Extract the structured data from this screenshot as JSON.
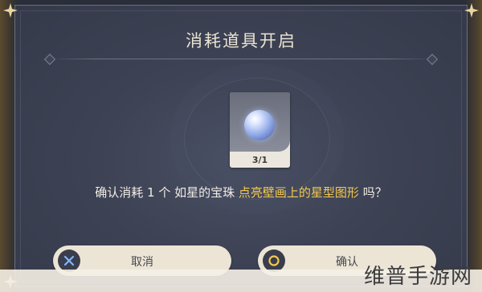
{
  "dialog": {
    "title": "消耗道具开启",
    "item": {
      "icon": "pearl-orb-icon",
      "count": "3/1"
    },
    "message": {
      "prefix": "确认消耗 1 个 如星的宝珠 ",
      "highlight": "点亮壁画上的星型图形",
      "suffix": " 吗？"
    },
    "cancel_button": {
      "label": "取消",
      "icon": "close-x-icon"
    },
    "confirm_button": {
      "label": "确认",
      "icon": "confirm-circle-icon"
    }
  },
  "watermark": "维普手游网",
  "colors": {
    "highlight": "#f5c94e",
    "panel": "#3d4254",
    "button": "#ece5d6"
  }
}
